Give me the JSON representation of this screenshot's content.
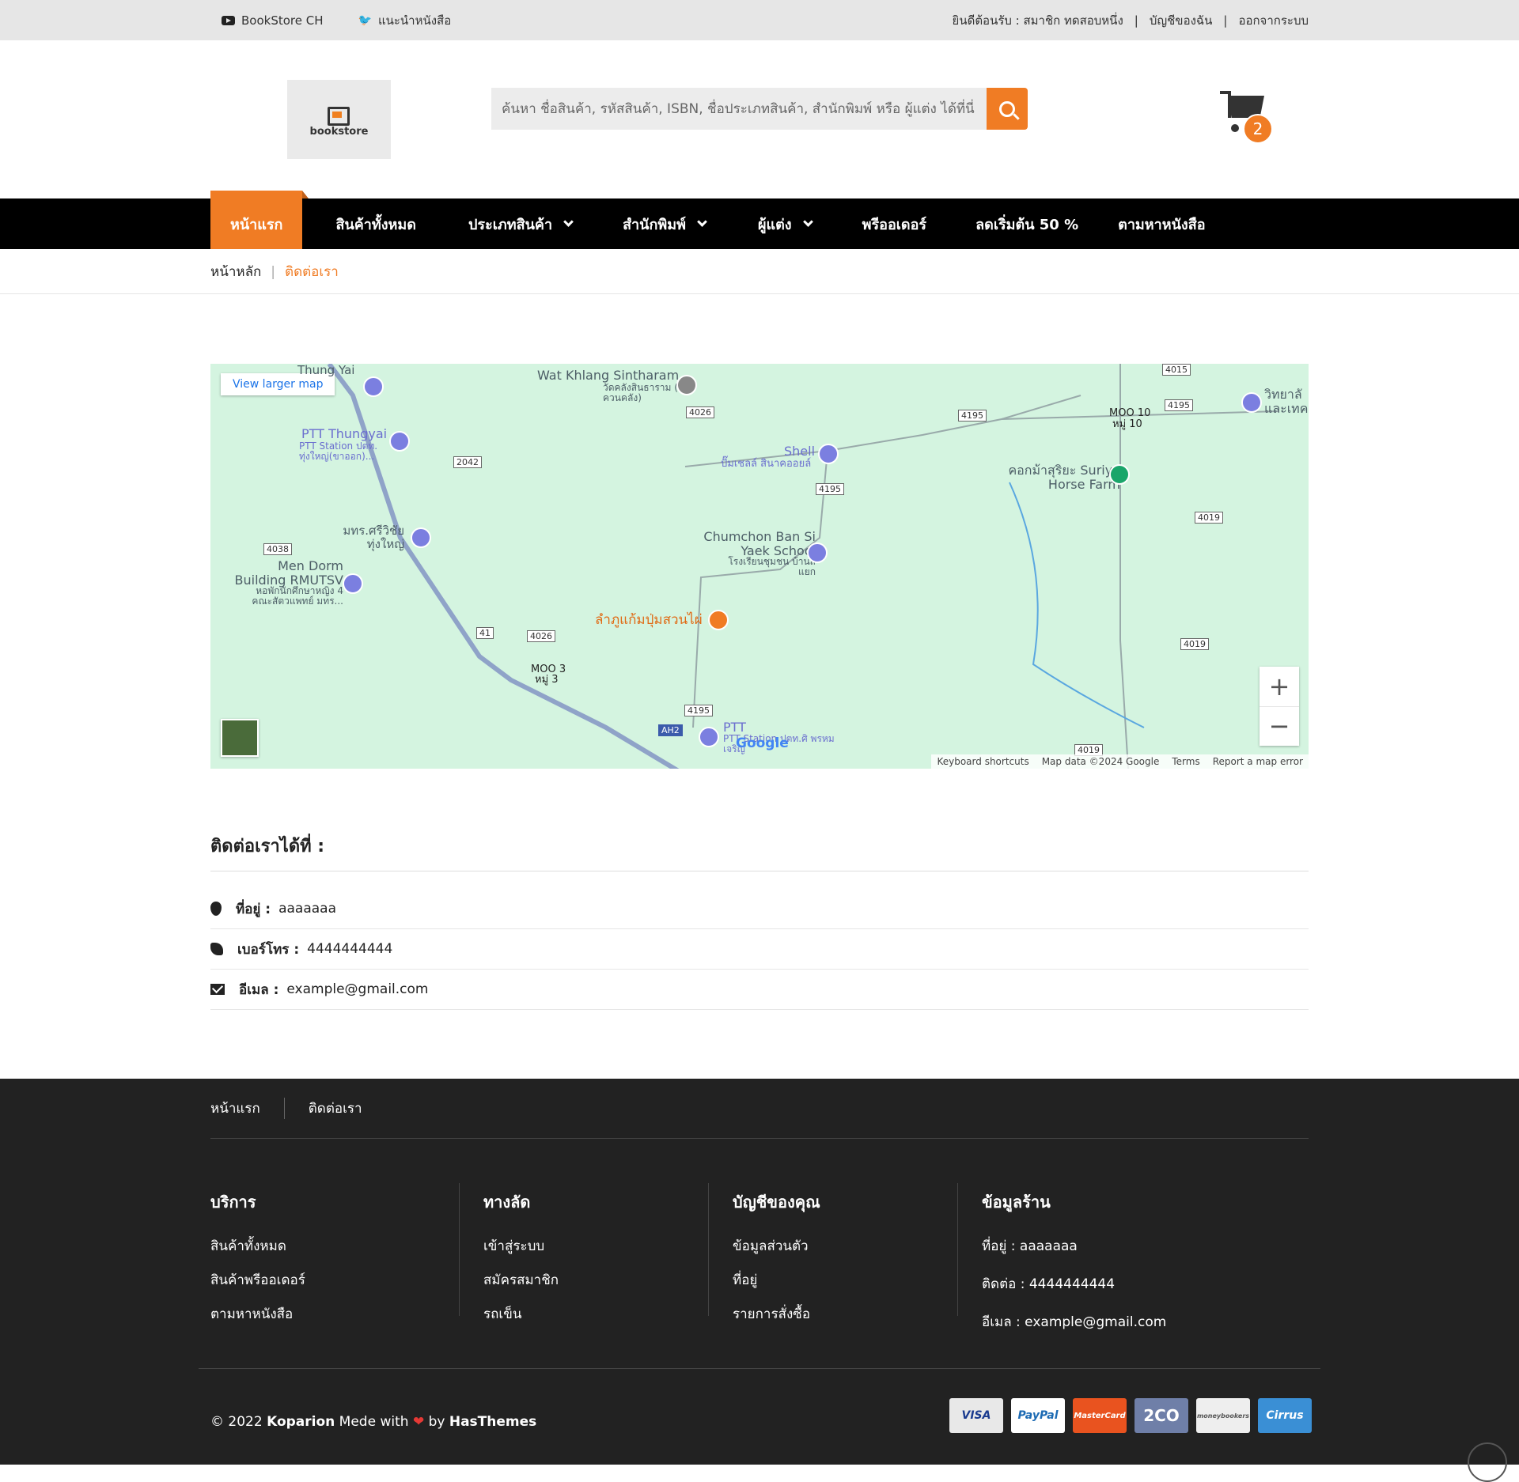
{
  "topbar": {
    "youtube": "BookStore CH",
    "twitter": "แนะนำหนังสือ",
    "welcome": "ยินดีต้อนรับ : สมาชิก ทดสอบหนึ่ง",
    "account": "บัญชีของฉัน",
    "logout": "ออกจากระบบ",
    "separator": "|"
  },
  "header": {
    "logo_text": "bookstore",
    "search_placeholder": "ค้นหา ชื่อสินค้า, รหัสสินค้า, ISBN, ชื่อประเภทสินค้า, สำนักพิมพ์ หรือ ผู้แต่ง ได้ที่นี่",
    "cart_count": "2"
  },
  "nav": {
    "items": [
      {
        "label": "หน้าแรก"
      },
      {
        "label": "สินค้าทั้งหมด"
      },
      {
        "label": "ประเภทสินค้า"
      },
      {
        "label": "สำนักพิมพ์"
      },
      {
        "label": "ผู้แต่ง"
      },
      {
        "label": "พรีออเดอร์"
      },
      {
        "label": "ลดเริ่มต้น 50 %"
      },
      {
        "label": "ตามหาหนังสือ"
      }
    ]
  },
  "breadcrumb": {
    "home": "หน้าหลัก",
    "current": "ติดต่อเรา",
    "separator": "|"
  },
  "map": {
    "view_larger": "View larger map",
    "zoom_in": "+",
    "zoom_out": "−",
    "google": "Google",
    "attrib": [
      "Keyboard shortcuts",
      "Map data ©2024 Google",
      "Terms",
      "Report a map error"
    ],
    "labels": {
      "wat": "Wat Khlang Sintharam",
      "wat_th": "วัดคลังสินธาราม (วัดควนคลัง)",
      "ptt1": "PTT Thungyai",
      "ptt1_th": "PTT Station ปตท. ทุ่งใหญ่(ขาออก)...",
      "thung": "Thung Yai",
      "rmu": "มทร.ศรีวิชัย ทุ่งใหญ่",
      "dorm": "Men Dorm Building RMUTSV",
      "dorm_th": "หอพักนักศึกษาหญิง 4 คณะสัตวแพทย์ มทร...",
      "shell": "Shell",
      "shell_th": "ปั๊มเชลล์ สินาคออยล์",
      "school": "Chumchon Ban Si Yaek School",
      "school_th": "โรงเรียนชุมชน บ้านสี่แยก",
      "restaurant": "ลำภูแก้มปุ่มสวนไผ่",
      "moo3": "MOO 3",
      "moo3_th": "หมู่ 3",
      "ptt2": "PTT",
      "ptt2_th": "PTT Station ปตท.ศิ พรหมเจริญ",
      "moo10": "MOO 10",
      "moo10_th": "หมู่ 10",
      "horse": "คอกม้าสุริยะ Suriya Horse Farm",
      "college": "วิทยาลั และเทค"
    },
    "roads": [
      "2042",
      "4038",
      "4026",
      "4026",
      "41",
      "4195",
      "4195",
      "4195",
      "4015",
      "4019",
      "4019",
      "4019",
      "4195",
      "AH2"
    ]
  },
  "contact": {
    "title": "ติดต่อเราได้ที่ :",
    "address_label": "ที่อยู่ :",
    "address": "aaaaaaa",
    "phone_label": "เบอร์โทร :",
    "phone": "4444444444",
    "email_label": "อีเมล :",
    "email": "example@gmail.com"
  },
  "footer": {
    "links": [
      "หน้าแรก",
      "ติดต่อเรา"
    ],
    "cols": [
      {
        "title": "บริการ",
        "items": [
          "สินค้าทั้งหมด",
          "สินค้าพรีออเดอร์",
          "ตามหาหนังสือ"
        ]
      },
      {
        "title": "ทางลัด",
        "items": [
          "เข้าสู่ระบบ",
          "สมัครสมาชิก",
          "รถเข็น"
        ]
      },
      {
        "title": "บัญชีของคุณ",
        "items": [
          "ข้อมูลส่วนตัว",
          "ที่อยู่",
          "รายการสั่งซื้อ"
        ]
      }
    ],
    "store": {
      "title": "ข้อมูลร้าน",
      "address": "ที่อยู่ : aaaaaaa",
      "phone": "ติดต่อ : 4444444444",
      "email": "อีเมล : example@gmail.com"
    },
    "copy_prefix": "© 2022",
    "copy_brand": "Koparion",
    "copy_middle": "Mede with",
    "copy_by": "by",
    "copy_author": "HasThemes",
    "payments": [
      "VISA",
      "PayPal",
      "MasterCard",
      "2CO",
      "moneybookers",
      "Cirrus"
    ]
  },
  "colors": {
    "accent": "#f07c24",
    "dark": "#222222",
    "nav": "#000000"
  }
}
